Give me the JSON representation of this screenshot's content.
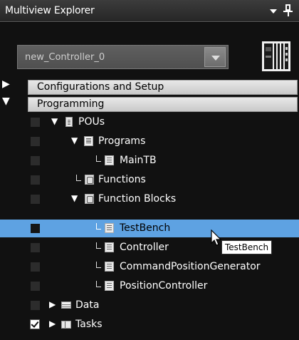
{
  "title_bar": {
    "title": "Multiview Explorer",
    "menu_icon": "dropdown-arrow-icon",
    "pin_icon": "pin-icon"
  },
  "controller_selector": {
    "value": "new_Controller_0",
    "device_icon": "controller-device-icon"
  },
  "categories": [
    {
      "label": "Configurations and Setup",
      "expanded": false
    },
    {
      "label": "Programming",
      "expanded": true
    }
  ],
  "tree": [
    {
      "label": "POUs",
      "icon": "pou-icon",
      "expanded": true
    },
    {
      "label": "Programs",
      "icon": "programs-icon",
      "expanded": true
    },
    {
      "label": "MainTB",
      "icon": "program-page-icon"
    },
    {
      "label": "Functions",
      "icon": "functions-icon"
    },
    {
      "label": "Function Blocks",
      "icon": "function-blocks-icon",
      "expanded": true
    },
    {
      "label": "TestBench",
      "icon": "function-block-page-icon",
      "selected": true
    },
    {
      "label": "Controller",
      "icon": "function-block-page-icon"
    },
    {
      "label": "CommandPositionGenerator",
      "icon": "function-block-page-icon"
    },
    {
      "label": "PositionController",
      "icon": "function-block-page-icon"
    },
    {
      "label": "Data",
      "icon": "data-icon",
      "expanded": false
    },
    {
      "label": "Tasks",
      "icon": "tasks-icon",
      "expanded": false,
      "checked": true
    }
  ],
  "tooltip": {
    "text": "TestBench"
  },
  "colors": {
    "selection": "#5ea2e2",
    "background": "#111111",
    "category_header": "#d8d8d8"
  }
}
